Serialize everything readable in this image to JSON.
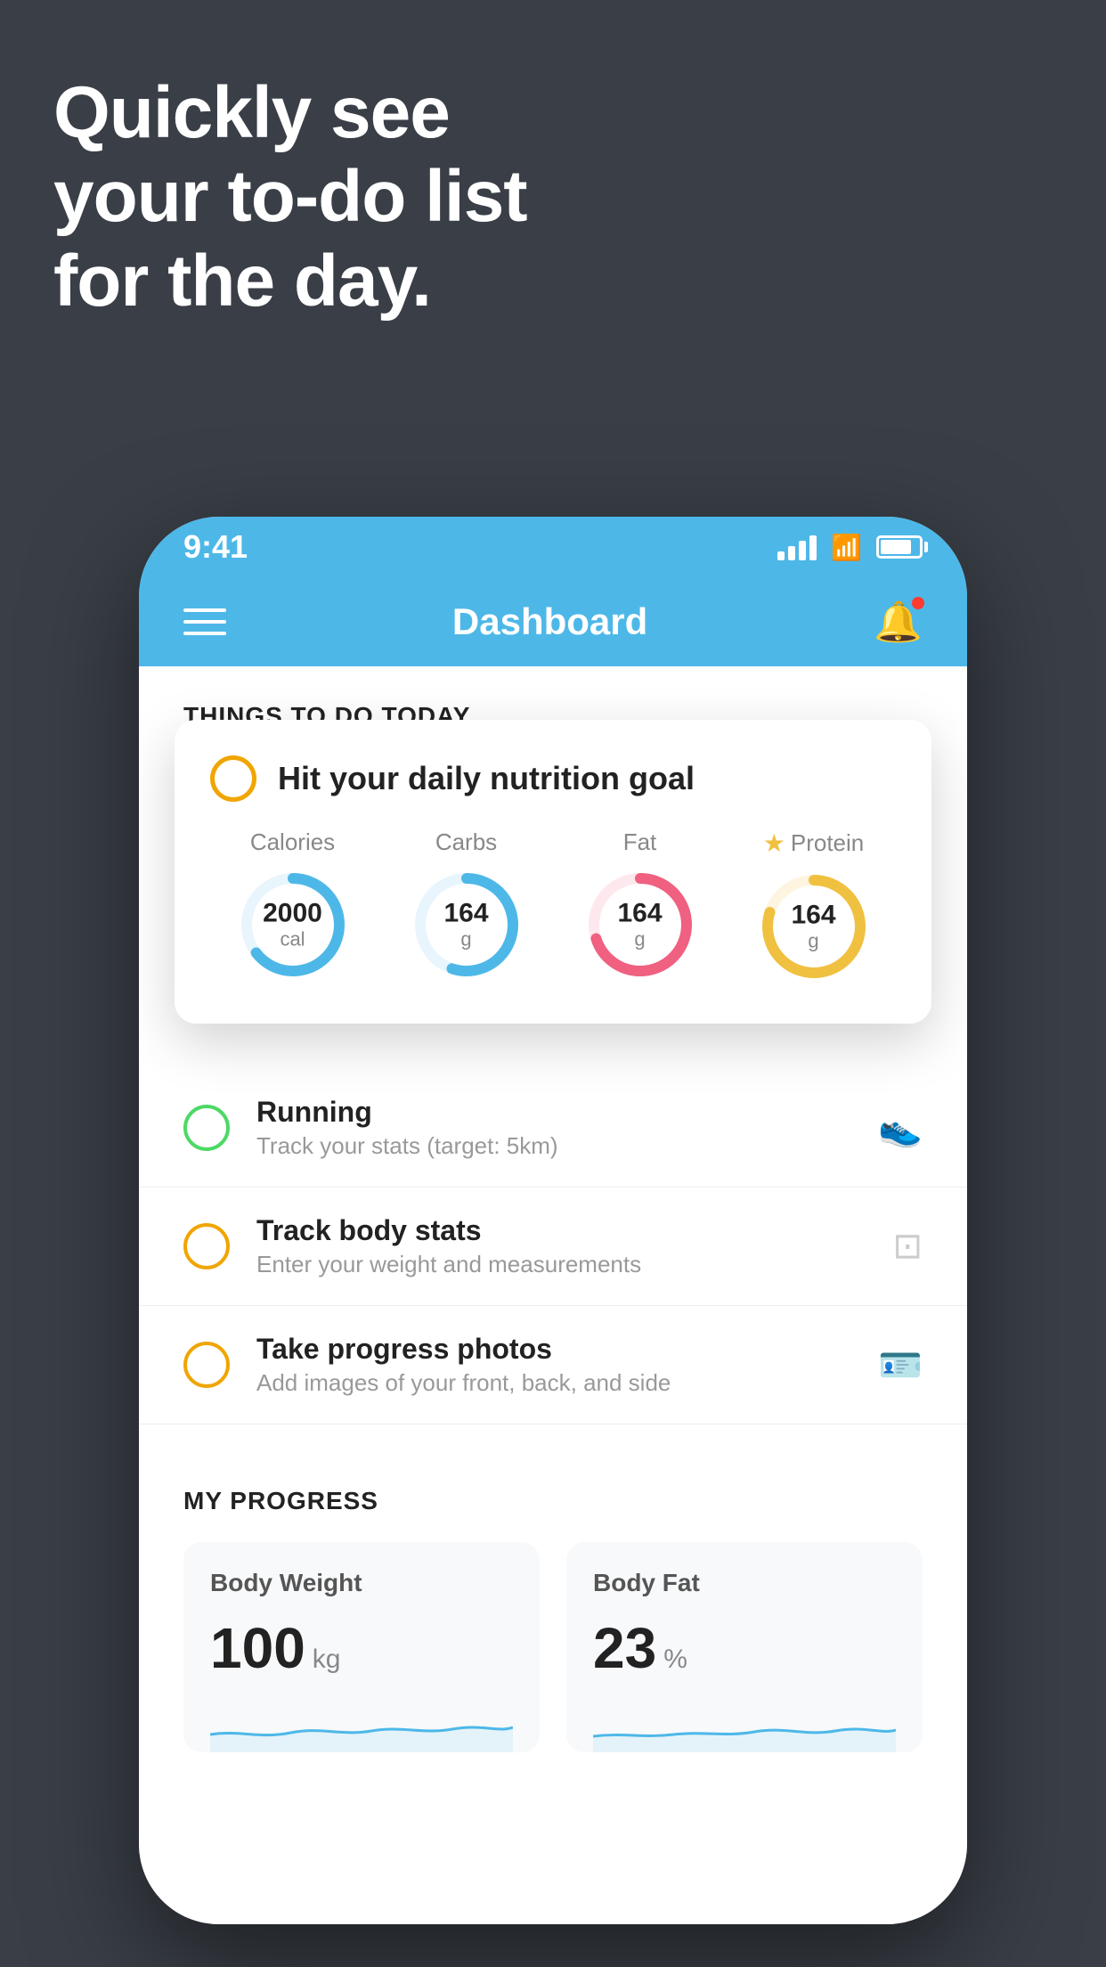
{
  "headline": {
    "line1": "Quickly see",
    "line2": "your to-do list",
    "line3": "for the day."
  },
  "status_bar": {
    "time": "9:41"
  },
  "header": {
    "title": "Dashboard"
  },
  "things_today": {
    "section_label": "THINGS TO DO TODAY"
  },
  "nutrition_card": {
    "circle_color": "#f0a500",
    "title": "Hit your daily nutrition goal",
    "items": [
      {
        "label": "Calories",
        "value": "2000",
        "unit": "cal",
        "color": "#4db8e8",
        "percent": 65,
        "has_star": false
      },
      {
        "label": "Carbs",
        "value": "164",
        "unit": "g",
        "color": "#4db8e8",
        "percent": 55,
        "has_star": false
      },
      {
        "label": "Fat",
        "value": "164",
        "unit": "g",
        "color": "#f06080",
        "percent": 70,
        "has_star": false
      },
      {
        "label": "Protein",
        "value": "164",
        "unit": "g",
        "color": "#f0c040",
        "percent": 80,
        "has_star": true
      }
    ]
  },
  "todo_items": [
    {
      "title": "Running",
      "subtitle": "Track your stats (target: 5km)",
      "circle_color": "green",
      "icon": "👟"
    },
    {
      "title": "Track body stats",
      "subtitle": "Enter your weight and measurements",
      "circle_color": "yellow",
      "icon": "⚖️"
    },
    {
      "title": "Take progress photos",
      "subtitle": "Add images of your front, back, and side",
      "circle_color": "yellow",
      "icon": "🪪"
    }
  ],
  "progress": {
    "section_label": "MY PROGRESS",
    "cards": [
      {
        "title": "Body Weight",
        "value": "100",
        "unit": "kg"
      },
      {
        "title": "Body Fat",
        "value": "23",
        "unit": "%"
      }
    ]
  }
}
